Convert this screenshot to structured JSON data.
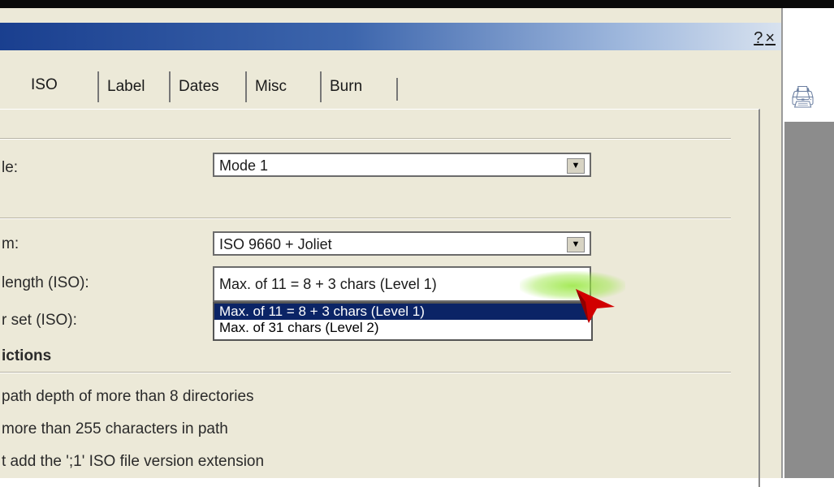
{
  "window": {
    "help_label": "?",
    "close_label": "×"
  },
  "tabs": [
    {
      "label": "ISO"
    },
    {
      "label": "Label"
    },
    {
      "label": "Dates"
    },
    {
      "label": "Misc"
    },
    {
      "label": "Burn"
    }
  ],
  "fields": {
    "mode": {
      "label": "le:",
      "value": "Mode 1"
    },
    "filesystem": {
      "label": "m:",
      "value": "ISO 9660 + Joliet"
    },
    "filename_length": {
      "label": "length (ISO):",
      "value": "Max. of 11 = 8 + 3 chars (Level 1)",
      "options": [
        "Max. of 11 = 8 + 3 chars (Level 1)",
        "Max. of 31 chars (Level 2)"
      ]
    },
    "charset": {
      "label": "r set (ISO):"
    }
  },
  "restrictions": {
    "heading": "ictions",
    "items": [
      "path depth of more than 8 directories",
      "more than 255 characters in path",
      "t add the ';1' ISO file version extension"
    ]
  },
  "colors": {
    "selection": "#0b2466",
    "pointer": "#d10000",
    "highlight": "#96e63c"
  }
}
